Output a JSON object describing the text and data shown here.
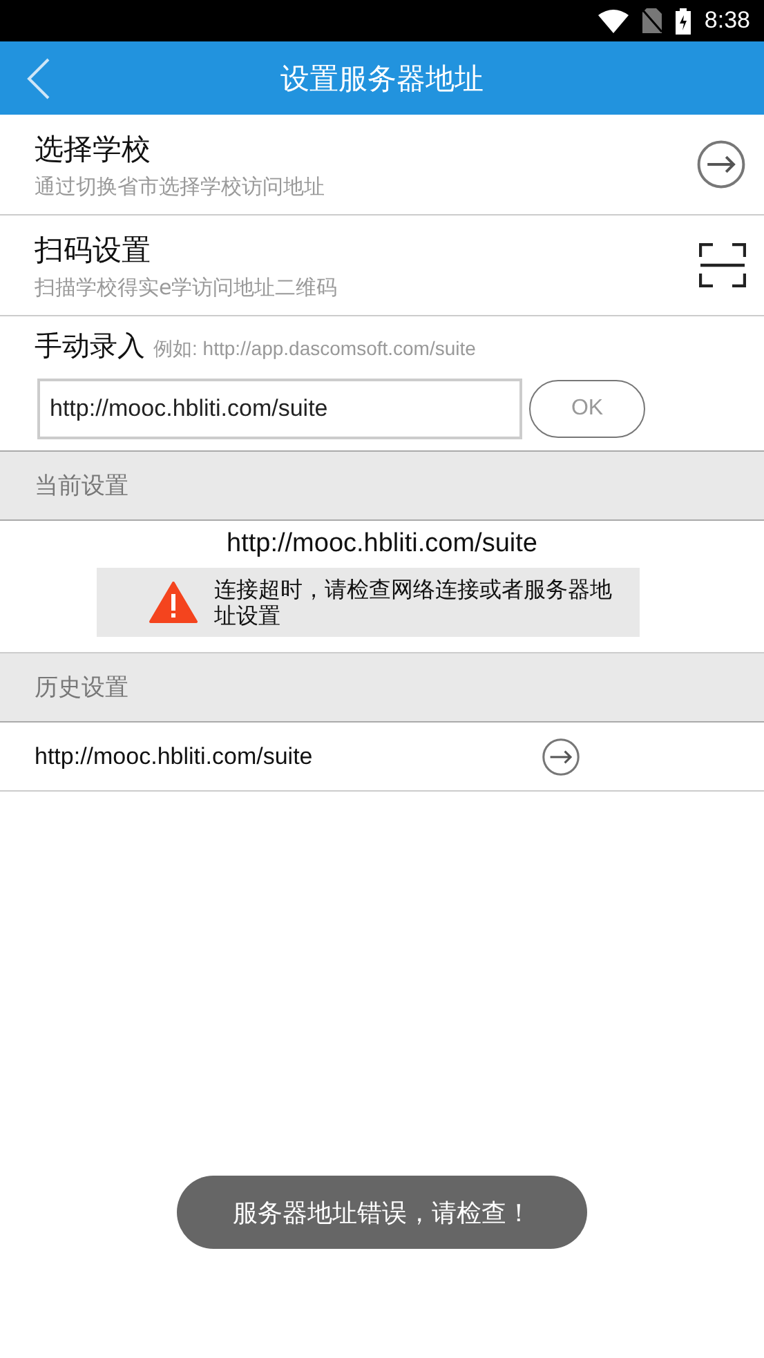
{
  "status_bar": {
    "time": "8:38"
  },
  "app_bar": {
    "title": "设置服务器地址"
  },
  "options": [
    {
      "kind": "arrow",
      "title": "选择学校",
      "subtitle": "通过切换省市选择学校访问地址"
    },
    {
      "kind": "scan",
      "title": "扫码设置",
      "subtitle": "扫描学校得实e学访问地址二维码"
    }
  ],
  "manual_entry": {
    "label": "手动录入",
    "example": "例如: http://app.dascomsoft.com/suite",
    "value": "http://mooc.hbliti.com/suite",
    "button": "OK"
  },
  "current": {
    "heading": "当前设置",
    "url": "http://mooc.hbliti.com/suite",
    "warning": "连接超时，请检查网络连接或者服务器地址设置"
  },
  "history": {
    "heading": "历史设置",
    "items": [
      "http://mooc.hbliti.com/suite"
    ]
  },
  "toast": "服务器地址错误，请检查！"
}
